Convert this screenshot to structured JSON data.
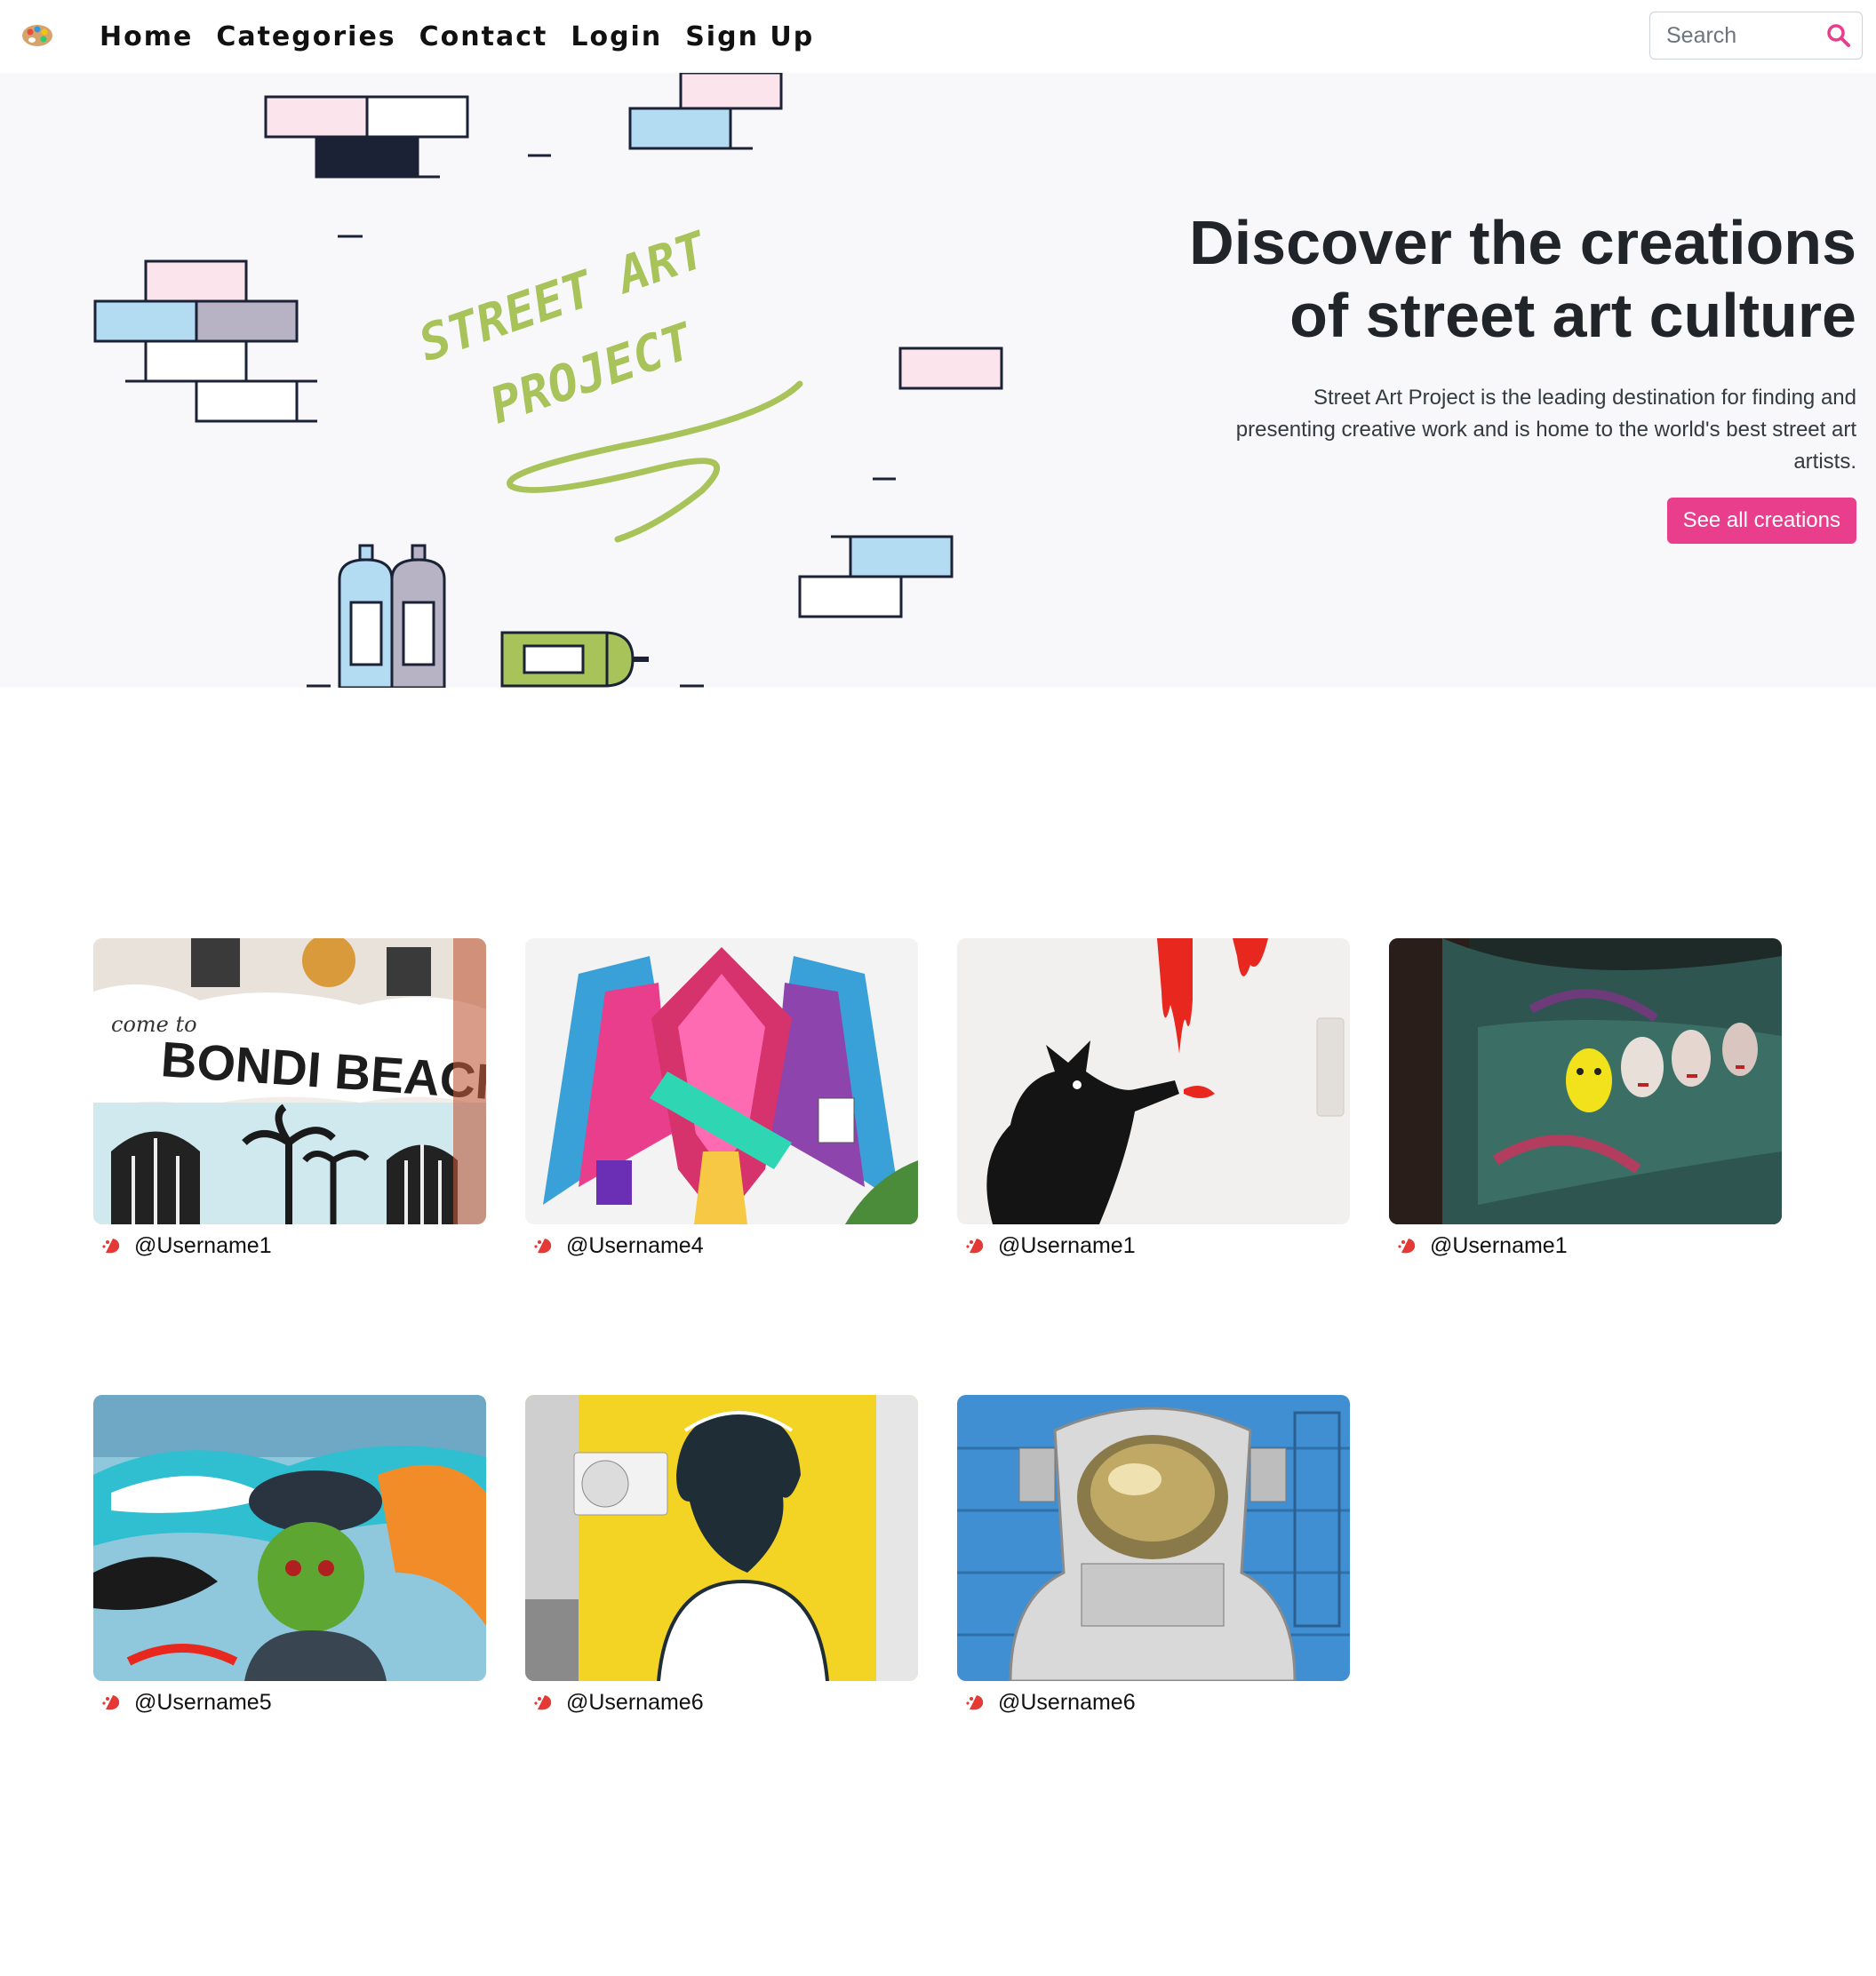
{
  "nav": {
    "logo_icon": "palette-icon",
    "links": [
      "Home",
      "Categories",
      "Contact",
      "Login",
      "Sign Up"
    ],
    "search_placeholder": "Search",
    "search_icon": "search-icon"
  },
  "hero": {
    "art_text_1": "STREET ART",
    "art_text_2": "PROJECT",
    "title_line1": "Discover the creations",
    "title_line2": "of street art culture",
    "description": "Street Art Project is the leading destination for finding and presenting creative work and is home to the world's best street art artists.",
    "button_label": "See all creations"
  },
  "colors": {
    "accent": "#e83e8c",
    "hero_bg": "#f8f8fb",
    "art_green": "#a8c35a",
    "brick_pink": "#fce4ec",
    "brick_blue": "#b3dcf2",
    "brick_grey": "#b8b3c4",
    "brick_navy": "#1b2236"
  },
  "gallery": {
    "items": [
      {
        "username": "@Username1",
        "image": "Bondi Beach mural"
      },
      {
        "username": "@Username4",
        "image": "colorful geometric bird mural"
      },
      {
        "username": "@Username1",
        "image": "stencil rat with red paint"
      },
      {
        "username": "@Username1",
        "image": "graffiti wall with masks"
      },
      {
        "username": "@Username5",
        "image": "graffiti character with cap"
      },
      {
        "username": "@Username6",
        "image": "girl on yellow wall"
      },
      {
        "username": "@Username6",
        "image": "astronaut mural on blue containers"
      }
    ],
    "user_icon": "spray-icon"
  }
}
